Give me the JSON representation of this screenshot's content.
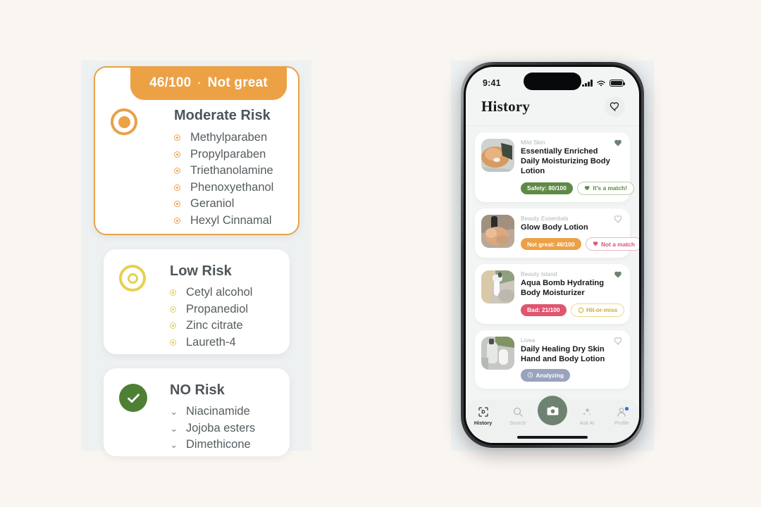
{
  "page": {
    "background_color": "#f9f5f1",
    "panel_background_color": "#eef1f2"
  },
  "left_panel": {
    "score_banner": {
      "score": "46/100",
      "separator": "·",
      "verdict": "Not great",
      "background_color": "#eda145",
      "text_color": "#ffffff"
    },
    "risk_groups": [
      {
        "title": "Moderate Risk",
        "icon": "filled-ring-icon",
        "accent_color": "#e8a14a",
        "bullet_style": "ring",
        "ingredients": [
          "Methylparaben",
          "Propylparaben",
          "Triethanolamine",
          "Phenoxyethanol",
          "Geraniol",
          "Hexyl Cinnamal"
        ]
      },
      {
        "title": "Low Risk",
        "icon": "double-ring-icon",
        "accent_color": "#e6d14f",
        "bullet_style": "ring",
        "ingredients": [
          "Cetyl alcohol",
          "Propanediol",
          "Zinc citrate",
          "Laureth-4"
        ]
      },
      {
        "title": "NO Risk",
        "icon": "check-circle-icon",
        "accent_color": "#4d8035",
        "bullet_style": "chevron",
        "ingredients": [
          "Niacinamide",
          "Jojoba esters",
          "Dimethicone"
        ]
      }
    ]
  },
  "phone": {
    "status_bar": {
      "time": "9:41",
      "cellular_icon": "signal-bars-icon",
      "wifi_icon": "wifi-icon",
      "battery_icon": "battery-icon"
    },
    "header": {
      "title": "History",
      "favorite_icon": "heart-outline-icon"
    },
    "products": [
      {
        "brand": "Mild Skin",
        "name": "Essentially Enriched Daily Moisturizing Body Lotion",
        "favorited": true,
        "favorite_icon": "heart-filled-icon",
        "thumbnail": "hand-cream-photo",
        "badges": [
          {
            "label": "Safety: 80/100",
            "style": "solid-green",
            "icon": null
          },
          {
            "label": "It's a match!",
            "style": "out-green",
            "icon": "heart-filled-icon"
          }
        ]
      },
      {
        "brand": "Beauty Essentials",
        "name": "Glow Body Lotion",
        "favorited": false,
        "favorite_icon": "heart-outline-icon",
        "thumbnail": "bottle-in-hand-photo",
        "badges": [
          {
            "label": "Not great: 46/100",
            "style": "solid-orange",
            "icon": null
          },
          {
            "label": "Not a match",
            "style": "out-pink",
            "icon": "heart-broken-icon"
          }
        ]
      },
      {
        "brand": "Beauty Island",
        "name": "Aqua Bomb Hydrating Body Moisturizer",
        "favorited": true,
        "favorite_icon": "heart-filled-icon",
        "thumbnail": "pump-bottle-photo",
        "badges": [
          {
            "label": "Bad: 21/100",
            "style": "solid-red",
            "icon": null
          },
          {
            "label": "Hit-or-miss",
            "style": "out-yellow",
            "icon": "ring-icon"
          }
        ]
      },
      {
        "brand": "Livea",
        "name": "Daily Healing Dry Skin Hand and Body Lotion",
        "favorited": false,
        "favorite_icon": "heart-outline-icon",
        "thumbnail": "white-bottles-photo",
        "badges": [
          {
            "label": "Analyzing",
            "style": "solid-slate",
            "icon": "clock-icon"
          }
        ]
      }
    ],
    "tabbar": {
      "items": [
        {
          "label": "History",
          "icon": "scan-frame-icon",
          "active": true
        },
        {
          "label": "Search",
          "icon": "search-icon",
          "active": false
        },
        {
          "label": "",
          "icon": "camera-icon",
          "active": false,
          "primary": true
        },
        {
          "label": "Ask AI",
          "icon": "sparkles-icon",
          "active": false
        },
        {
          "label": "Profile",
          "icon": "person-icon",
          "active": false,
          "badge": true
        }
      ],
      "camera_button_color": "#6d8270"
    }
  }
}
